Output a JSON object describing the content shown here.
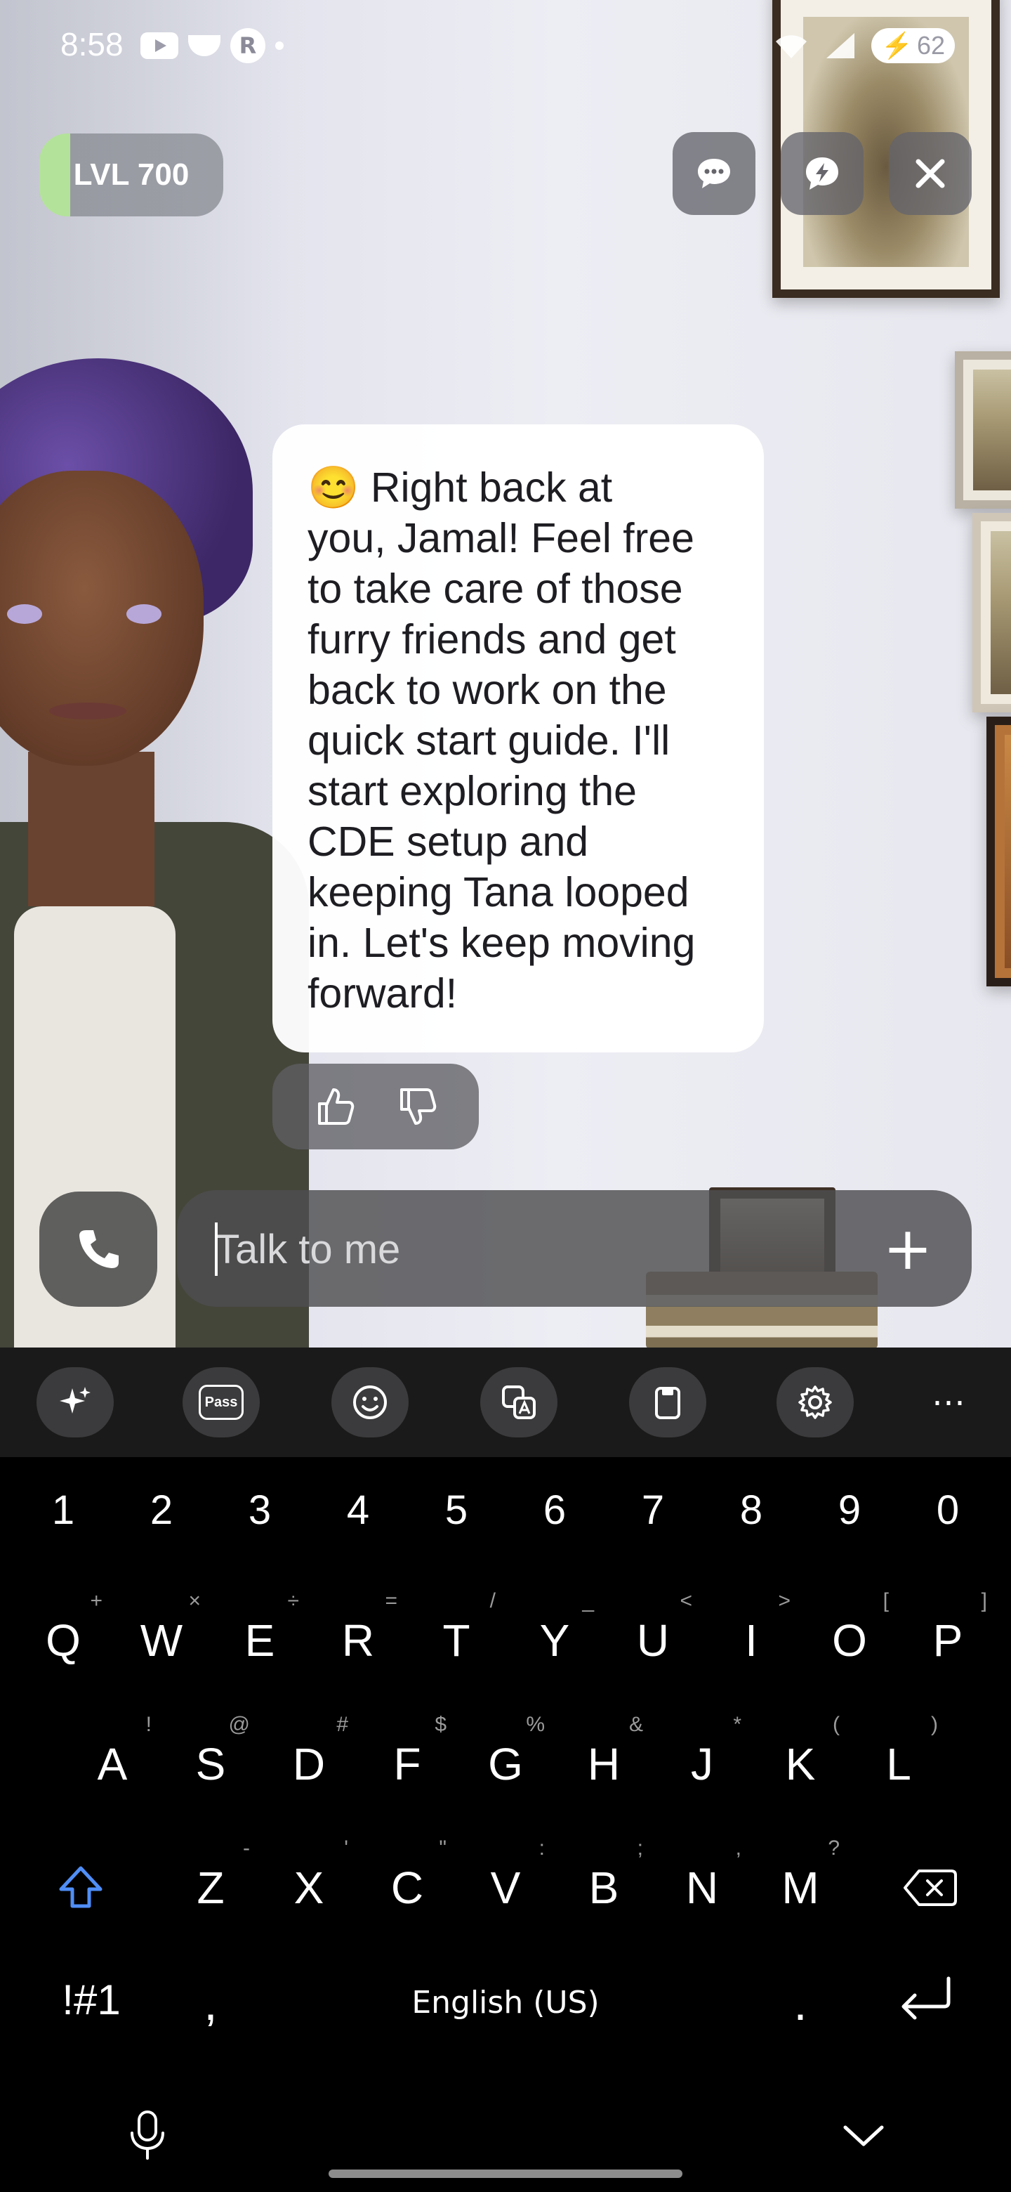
{
  "status_bar": {
    "time": "8:58",
    "left_icons": [
      "youtube-icon",
      "bowl-icon",
      "r-badge-icon",
      "dot-icon"
    ],
    "right_icons": [
      "wifi-icon",
      "signal-icon"
    ],
    "battery": "62"
  },
  "header": {
    "level_label": "LVL 700",
    "level_progress": 0.05,
    "buttons": [
      "chat-bubble-icon",
      "lightning-bubble-icon",
      "close-icon"
    ]
  },
  "chat": {
    "message": "😊 Right back at\nyou, Jamal! Feel free\nto take care of those\nfurry friends and get\nback to work on the\nquick start guide. I'll\nstart exploring the\nCDE setup and\nkeeping Tana looped\nin. Let's keep moving\nforward!",
    "feedback": [
      "thumbs-up-icon",
      "thumbs-down-icon"
    ]
  },
  "composer": {
    "placeholder": "Talk to me",
    "value": "",
    "call_icon": "phone-icon",
    "attach_icon": "plus-icon"
  },
  "keyboard": {
    "toolbar": [
      "sparkle-icon",
      "pass-icon",
      "emoji-icon",
      "translate-icon",
      "clipboard-icon",
      "settings-icon",
      "more-icon"
    ],
    "pass_label": "Pass",
    "numbers": [
      "1",
      "2",
      "3",
      "4",
      "5",
      "6",
      "7",
      "8",
      "9",
      "0"
    ],
    "row1": [
      "Q",
      "W",
      "E",
      "R",
      "T",
      "Y",
      "U",
      "I",
      "O",
      "P"
    ],
    "row1_sub": [
      "+",
      "×",
      "÷",
      "=",
      "/",
      "_",
      "<",
      ">",
      "[",
      "]"
    ],
    "row2": [
      "A",
      "S",
      "D",
      "F",
      "G",
      "H",
      "J",
      "K",
      "L"
    ],
    "row2_sub": [
      "!",
      "@",
      "#",
      "$",
      "%",
      "&",
      "*",
      "(",
      ")"
    ],
    "row3": [
      "Z",
      "X",
      "C",
      "V",
      "B",
      "N",
      "M"
    ],
    "row3_sub": [
      "-",
      "'",
      "\"",
      ":",
      ";",
      ",",
      "?"
    ],
    "symbols_key": "!#1",
    "comma_key": ",",
    "space_label": "English (US)",
    "period_key": ".",
    "bottom_icons": [
      "microphone-icon",
      "chevron-down-icon"
    ]
  }
}
